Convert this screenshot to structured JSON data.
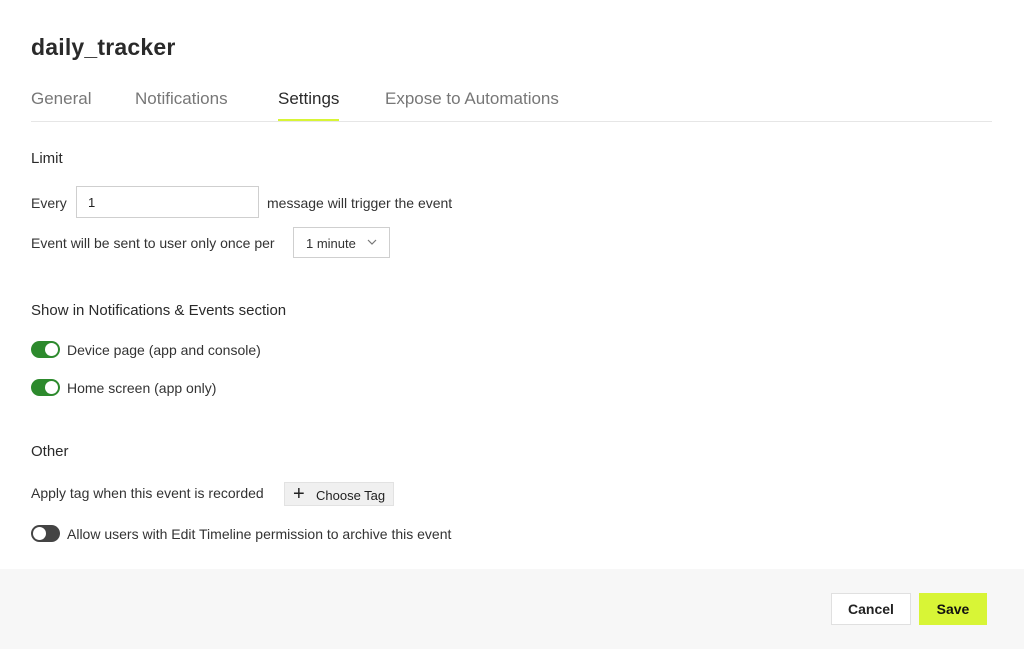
{
  "dialog": {
    "title": "daily_tracker"
  },
  "tabs": [
    {
      "label": "General",
      "active": false
    },
    {
      "label": "Notifications",
      "active": false
    },
    {
      "label": "Settings",
      "active": true
    },
    {
      "label": "Expose to Automations",
      "active": false
    }
  ],
  "limit": {
    "heading": "Limit",
    "every_label": "Every",
    "every_value": "1",
    "message_suffix": "message will trigger the event",
    "once_per_label": "Event will be sent to user only once per",
    "interval_selected": "1 minute"
  },
  "show_section": {
    "heading": "Show in Notifications & Events section",
    "device_page_label": "Device page (app and console)",
    "device_page_on": true,
    "home_screen_label": "Home screen (app only)",
    "home_screen_on": true
  },
  "other": {
    "heading": "Other",
    "apply_tag_label": "Apply tag when this event is recorded",
    "choose_tag_label": "Choose Tag",
    "archive_label": "Allow users with Edit Timeline permission to archive this event",
    "archive_on": false
  },
  "footer": {
    "cancel_label": "Cancel",
    "save_label": "Save"
  },
  "colors": {
    "accent": "#d8f536",
    "toggle_on": "#2d8a2d",
    "toggle_off": "#444444",
    "footer_bg": "#f7f7f7"
  }
}
